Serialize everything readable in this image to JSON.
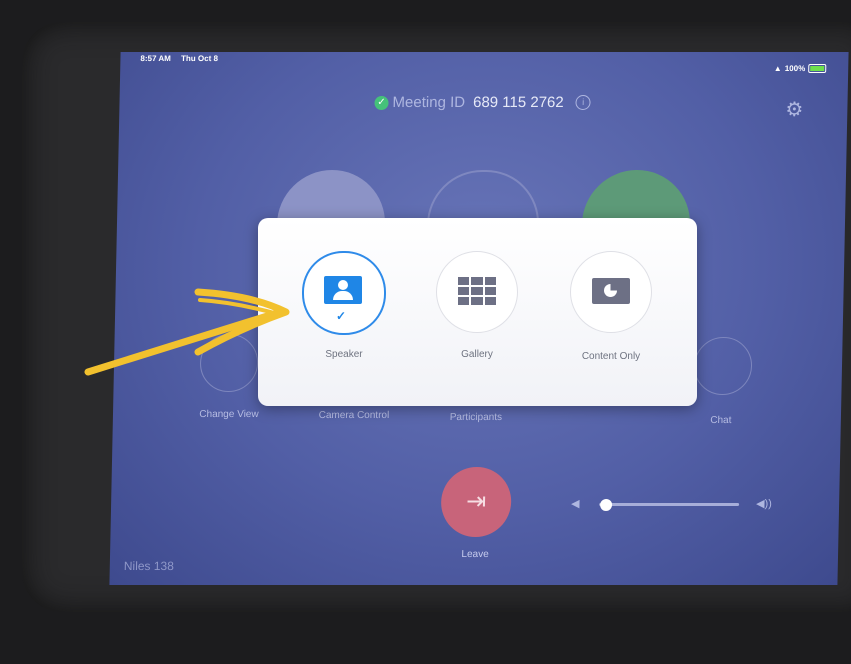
{
  "status_bar": {
    "time": "8:57 AM",
    "date": "Thu Oct 8",
    "battery": "100%"
  },
  "meeting": {
    "label": "Meeting ID",
    "id": "689 115 2762"
  },
  "controls": [
    {
      "label": "Change View"
    },
    {
      "label": "Camera Control"
    },
    {
      "label": "Participants"
    },
    {
      "label": "Chat"
    }
  ],
  "leave": {
    "label": "Leave"
  },
  "room_name": "Niles 138",
  "volume": {
    "level": 0.05
  },
  "view_dialog": {
    "selected": "Speaker",
    "options": [
      {
        "label": "Speaker"
      },
      {
        "label": "Gallery"
      },
      {
        "label": "Content Only"
      }
    ]
  },
  "colors": {
    "accent": "#1f86e6",
    "background": "#525fa6",
    "annotation": "#f2c12e"
  }
}
